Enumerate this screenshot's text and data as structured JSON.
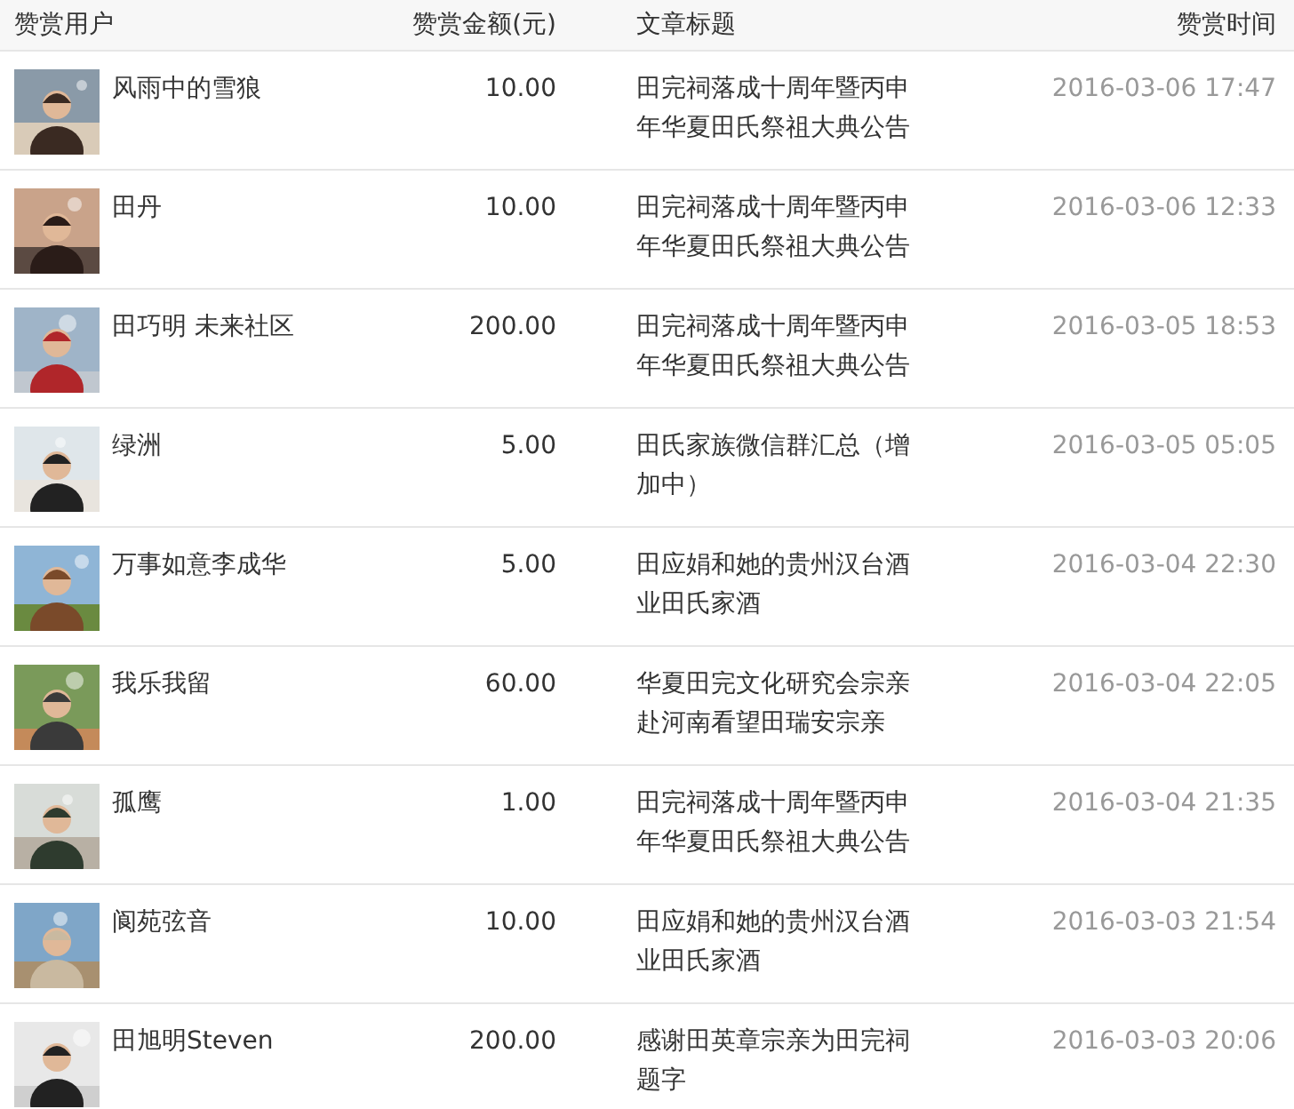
{
  "columns": [
    "赞赏用户",
    "赞赏金额(元)",
    "文章标题",
    "赞赏时间"
  ],
  "rows": [
    {
      "user": "风雨中的雪狼",
      "amount": "10.00",
      "title": "田完祠落成十周年暨丙申年华夏田氏祭祖大典公告",
      "time": "2016-03-06 17:47"
    },
    {
      "user": "田丹",
      "amount": "10.00",
      "title": "田完祠落成十周年暨丙申年华夏田氏祭祖大典公告",
      "time": "2016-03-06 12:33"
    },
    {
      "user": "田巧明 未来社区",
      "amount": "200.00",
      "title": "田完祠落成十周年暨丙申年华夏田氏祭祖大典公告",
      "time": "2016-03-05 18:53"
    },
    {
      "user": "绿洲",
      "amount": "5.00",
      "title": "田氏家族微信群汇总（增加中）",
      "time": "2016-03-05 05:05"
    },
    {
      "user": "万事如意李成华",
      "amount": "5.00",
      "title": "田应娟和她的贵州汉台酒业田氏家酒",
      "time": "2016-03-04 22:30"
    },
    {
      "user": "我乐我留",
      "amount": "60.00",
      "title": "华夏田完文化研究会宗亲赴河南看望田瑞安宗亲",
      "time": "2016-03-04 22:05"
    },
    {
      "user": "孤鹰",
      "amount": "1.00",
      "title": "田完祠落成十周年暨丙申年华夏田氏祭祖大典公告",
      "time": "2016-03-04 21:35"
    },
    {
      "user": "阆苑弦音",
      "amount": "10.00",
      "title": "田应娟和她的贵州汉台酒业田氏家酒",
      "time": "2016-03-03 21:54"
    },
    {
      "user": "田旭明Steven",
      "amount": "200.00",
      "title": "感谢田英章宗亲为田完祠题字",
      "time": "2016-03-03 20:06"
    }
  ]
}
